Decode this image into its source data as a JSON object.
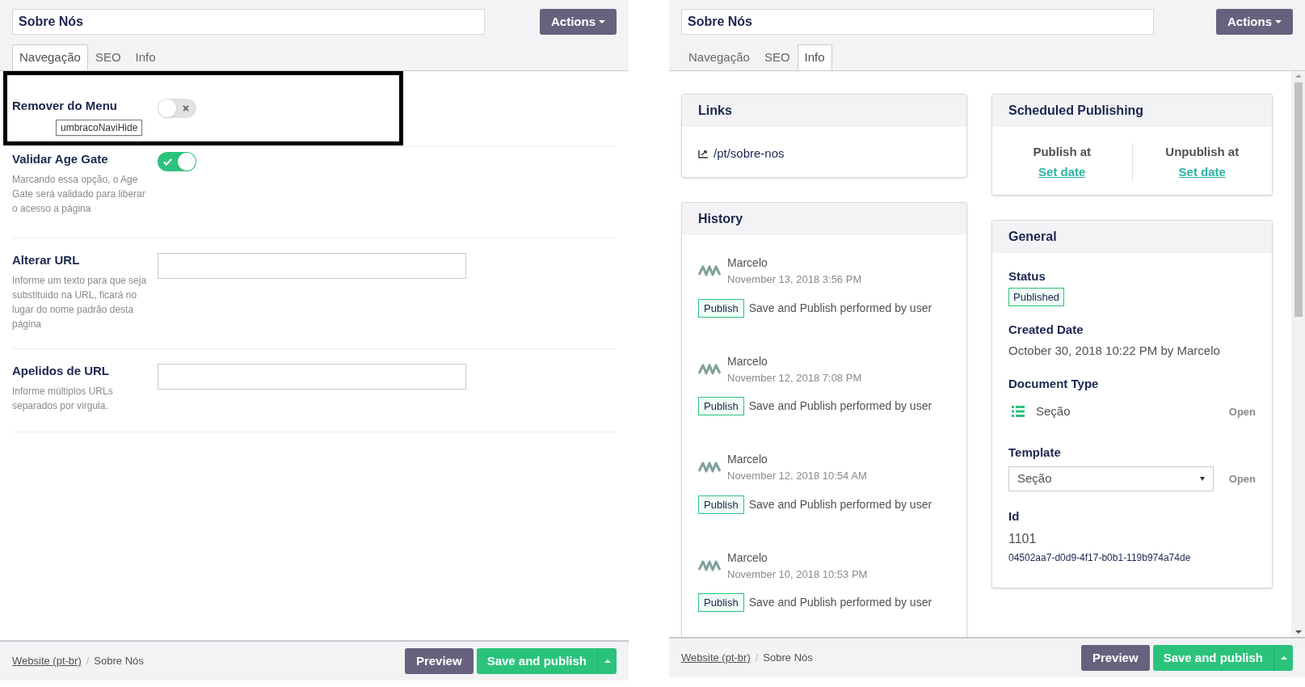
{
  "left": {
    "title": "Sobre Nós",
    "actions": "Actions",
    "tabs": [
      {
        "label": "Navegação",
        "selected": true
      },
      {
        "label": "SEO",
        "selected": false
      },
      {
        "label": "Info",
        "selected": false
      }
    ],
    "properties": [
      {
        "kind": "toggle",
        "label": "Remover do Menu",
        "on": false,
        "tooltip": "umbracoNaviHide",
        "highlighted": true
      },
      {
        "kind": "toggle",
        "label": "Validar Age Gate",
        "on": true,
        "description": "Marcando essa opção, o Age Gate será validado para liberar o acesso a página",
        "highlighted": false
      },
      {
        "kind": "text",
        "label": "Alterar URL",
        "description": "Informe um texto para que seja substituido na URL, ficará no lugar do nome padrão desta página",
        "highlighted": false
      },
      {
        "kind": "text",
        "label": "Apelidos de URL",
        "description": "Informe múltiplos URLs separados por virgula.",
        "highlighted": false
      }
    ],
    "breadcrumb": {
      "link": "Website (pt-br)",
      "separator": "/",
      "current": "Sobre Nós"
    },
    "buttons": {
      "preview": "Preview",
      "save": "Save and publish"
    }
  },
  "right": {
    "title": "Sobre Nós",
    "actions": "Actions",
    "tabs": [
      {
        "label": "Navegação",
        "selected": false
      },
      {
        "label": "SEO",
        "selected": false
      },
      {
        "label": "Info",
        "selected": true
      }
    ],
    "links": {
      "title": "Links",
      "url": "/pt/sobre-nos"
    },
    "history": {
      "title": "History",
      "items": [
        {
          "user": "Marcelo",
          "date": "November 13, 2018 3:56 PM",
          "badge": "Publish",
          "action": "Save and Publish performed by user"
        },
        {
          "user": "Marcelo",
          "date": "November 12, 2018 7:08 PM",
          "badge": "Publish",
          "action": "Save and Publish performed by user"
        },
        {
          "user": "Marcelo",
          "date": "November 12, 2018 10:54 AM",
          "badge": "Publish",
          "action": "Save and Publish performed by user"
        },
        {
          "user": "Marcelo",
          "date": "November 10, 2018 10:53 PM",
          "badge": "Publish",
          "action": "Save and Publish performed by user"
        }
      ]
    },
    "scheduled": {
      "title": "Scheduled Publishing",
      "publish_label": "Publish at",
      "publish_link": "Set date",
      "unpublish_label": "Unpublish at",
      "unpublish_link": "Set date"
    },
    "general": {
      "title": "General",
      "status_label": "Status",
      "status": "Published",
      "created_label": "Created Date",
      "created": "October 30, 2018 10:22 PM by Marcelo",
      "doctype_label": "Document Type",
      "doctype": "Seção",
      "doctype_open": "Open",
      "template_label": "Template",
      "template": "Seção",
      "template_open": "Open",
      "id_label": "Id",
      "id": "1101",
      "guid": "04502aa7-d0d9-4f17-b0b1-119b974a74de"
    },
    "breadcrumb": {
      "link": "Website (pt-br)",
      "separator": "/",
      "current": "Sobre Nós"
    },
    "buttons": {
      "preview": "Preview",
      "save": "Save and publish"
    }
  }
}
